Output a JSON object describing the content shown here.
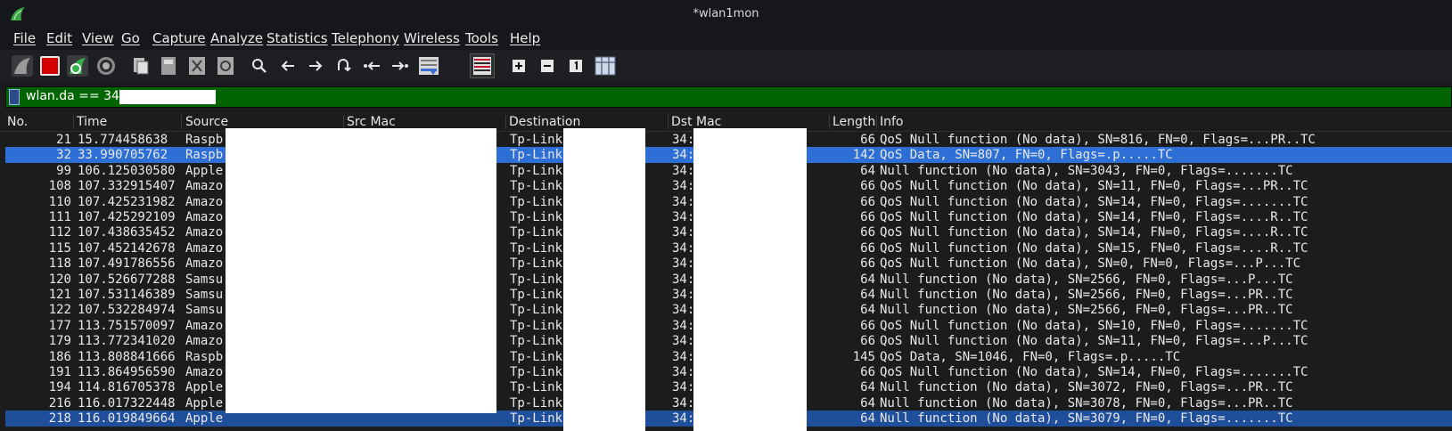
{
  "window": {
    "title": "*wlan1mon"
  },
  "menu": [
    "File",
    "Edit",
    "View",
    "Go",
    "Capture",
    "Analyze",
    "Statistics",
    "Telephony",
    "Wireless",
    "Tools",
    "Help"
  ],
  "toolbar": [
    "shark-fin-icon",
    "stop-capture-icon",
    "restart-capture-icon",
    "capture-options-icon",
    "open-file-icon",
    "save-file-icon",
    "close-file-icon",
    "reload-file-icon",
    "find-packet-icon",
    "go-back-icon",
    "go-forward-icon",
    "go-to-packet-icon",
    "first-packet-icon",
    "last-packet-icon",
    "autoscroll-icon",
    "colorize-icon",
    "zoom-in-icon",
    "zoom-out-icon",
    "normal-size-icon",
    "resize-columns-icon"
  ],
  "filter": {
    "value": "wlan.da == 34:"
  },
  "columns": {
    "no": "No.",
    "time": "Time",
    "source": "Source",
    "src_mac": "Src Mac",
    "destination": "Destination",
    "dst_mac": "Dst Mac",
    "length": "Length",
    "info": "Info"
  },
  "packets": [
    {
      "no": "21",
      "time": "15.774458638",
      "source": "Raspb",
      "destination": "Tp-Link",
      "dst_mac": "34:",
      "length": "66",
      "info": "QoS Null function (No data), SN=816, FN=0, Flags=...PR..TC"
    },
    {
      "no": "32",
      "time": "33.990705762",
      "source": "Raspb",
      "destination": "Tp-Link",
      "dst_mac": "34:",
      "length": "142",
      "info": "QoS Data, SN=807, FN=0, Flags=.p.....TC"
    },
    {
      "no": "99",
      "time": "106.125030580",
      "source": "Apple",
      "destination": "Tp-Link",
      "dst_mac": "34:",
      "length": "64",
      "info": "Null function (No data), SN=3043, FN=0, Flags=.......TC"
    },
    {
      "no": "108",
      "time": "107.332915407",
      "source": "Amazo",
      "destination": "Tp-Link",
      "dst_mac": "34:",
      "length": "66",
      "info": "QoS Null function (No data), SN=11, FN=0, Flags=...PR..TC"
    },
    {
      "no": "110",
      "time": "107.425231982",
      "source": "Amazo",
      "destination": "Tp-Link",
      "dst_mac": "34:",
      "length": "66",
      "info": "QoS Null function (No data), SN=14, FN=0, Flags=.......TC"
    },
    {
      "no": "111",
      "time": "107.425292109",
      "source": "Amazo",
      "destination": "Tp-Link",
      "dst_mac": "34:",
      "length": "66",
      "info": "QoS Null function (No data), SN=14, FN=0, Flags=....R..TC"
    },
    {
      "no": "112",
      "time": "107.438635452",
      "source": "Amazo",
      "destination": "Tp-Link",
      "dst_mac": "34:",
      "length": "66",
      "info": "QoS Null function (No data), SN=14, FN=0, Flags=....R..TC"
    },
    {
      "no": "115",
      "time": "107.452142678",
      "source": "Amazo",
      "destination": "Tp-Link",
      "dst_mac": "34:",
      "length": "66",
      "info": "QoS Null function (No data), SN=15, FN=0, Flags=....R..TC"
    },
    {
      "no": "118",
      "time": "107.491786556",
      "source": "Amazo",
      "destination": "Tp-Link",
      "dst_mac": "34:",
      "length": "66",
      "info": "QoS Null function (No data), SN=0, FN=0, Flags=...P...TC"
    },
    {
      "no": "120",
      "time": "107.526677288",
      "source": "Samsu",
      "destination": "Tp-Link",
      "dst_mac": "34:",
      "length": "64",
      "info": "Null function (No data), SN=2566, FN=0, Flags=...P...TC"
    },
    {
      "no": "121",
      "time": "107.531146389",
      "source": "Samsu",
      "destination": "Tp-Link",
      "dst_mac": "34:",
      "length": "64",
      "info": "Null function (No data), SN=2566, FN=0, Flags=...PR..TC"
    },
    {
      "no": "122",
      "time": "107.532284974",
      "source": "Samsu",
      "destination": "Tp-Link",
      "dst_mac": "34:",
      "length": "64",
      "info": "Null function (No data), SN=2566, FN=0, Flags=...PR..TC"
    },
    {
      "no": "177",
      "time": "113.751570097",
      "source": "Amazo",
      "destination": "Tp-Link",
      "dst_mac": "34:",
      "length": "66",
      "info": "QoS Null function (No data), SN=10, FN=0, Flags=.......TC"
    },
    {
      "no": "179",
      "time": "113.772341020",
      "source": "Amazo",
      "destination": "Tp-Link",
      "dst_mac": "34:",
      "length": "66",
      "info": "QoS Null function (No data), SN=11, FN=0, Flags=...P...TC"
    },
    {
      "no": "186",
      "time": "113.808841666",
      "source": "Raspb",
      "destination": "Tp-Link",
      "dst_mac": "34:",
      "length": "145",
      "info": "QoS Data, SN=1046, FN=0, Flags=.p.....TC"
    },
    {
      "no": "191",
      "time": "113.864956590",
      "source": "Amazo",
      "destination": "Tp-Link",
      "dst_mac": "34:",
      "length": "66",
      "info": "QoS Null function (No data), SN=14, FN=0, Flags=.......TC"
    },
    {
      "no": "194",
      "time": "114.816705378",
      "source": "Apple",
      "destination": "Tp-Link",
      "dst_mac": "34:",
      "length": "64",
      "info": "Null function (No data), SN=3072, FN=0, Flags=...PR..TC"
    },
    {
      "no": "216",
      "time": "116.017322448",
      "source": "Apple",
      "destination": "Tp-Link",
      "dst_mac": "34:",
      "length": "64",
      "info": "Null function (No data), SN=3078, FN=0, Flags=...PR..TC"
    },
    {
      "no": "218",
      "time": "116.019849664",
      "source": "Apple",
      "destination": "Tp-Link",
      "dst_mac": "34:",
      "length": "64",
      "info": "Null function (No data), SN=3079, FN=0, Flags=.......TC"
    }
  ],
  "selected_index": 1,
  "colors": {
    "filter_valid": "#006400",
    "selection": "#2e6fd6",
    "background": "#1b1c1e"
  }
}
